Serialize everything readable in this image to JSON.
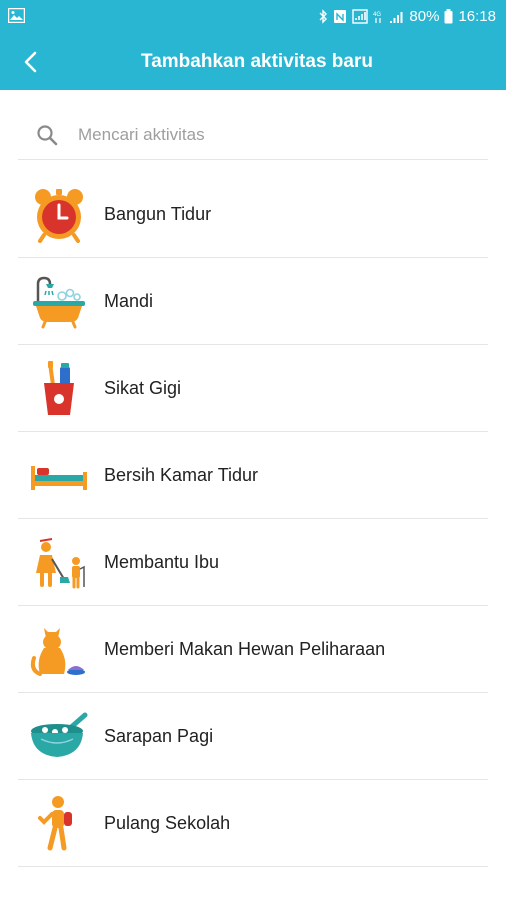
{
  "status_bar": {
    "battery": "80%",
    "time": "16:18"
  },
  "app_bar": {
    "title": "Tambahkan aktivitas baru",
    "back_icon": "arrow-left-icon"
  },
  "search": {
    "placeholder": "Mencari aktivitas",
    "value": ""
  },
  "colors": {
    "primary": "#29b6d2",
    "icon_orange": "#f59a23",
    "icon_red": "#d9342b",
    "icon_teal": "#2aa8a6"
  },
  "activities": [
    {
      "label": "Bangun Tidur",
      "icon": "alarm-clock-icon"
    },
    {
      "label": "Mandi",
      "icon": "bathtub-icon"
    },
    {
      "label": "Sikat Gigi",
      "icon": "toothbrush-cup-icon"
    },
    {
      "label": "Bersih Kamar Tidur",
      "icon": "bed-icon"
    },
    {
      "label": "Membantu Ibu",
      "icon": "mother-child-sweeping-icon"
    },
    {
      "label": "Memberi Makan Hewan Peliharaan",
      "icon": "cat-food-bowl-icon"
    },
    {
      "label": "Sarapan Pagi",
      "icon": "breakfast-bowl-icon"
    },
    {
      "label": "Pulang Sekolah",
      "icon": "student-walking-icon"
    }
  ]
}
